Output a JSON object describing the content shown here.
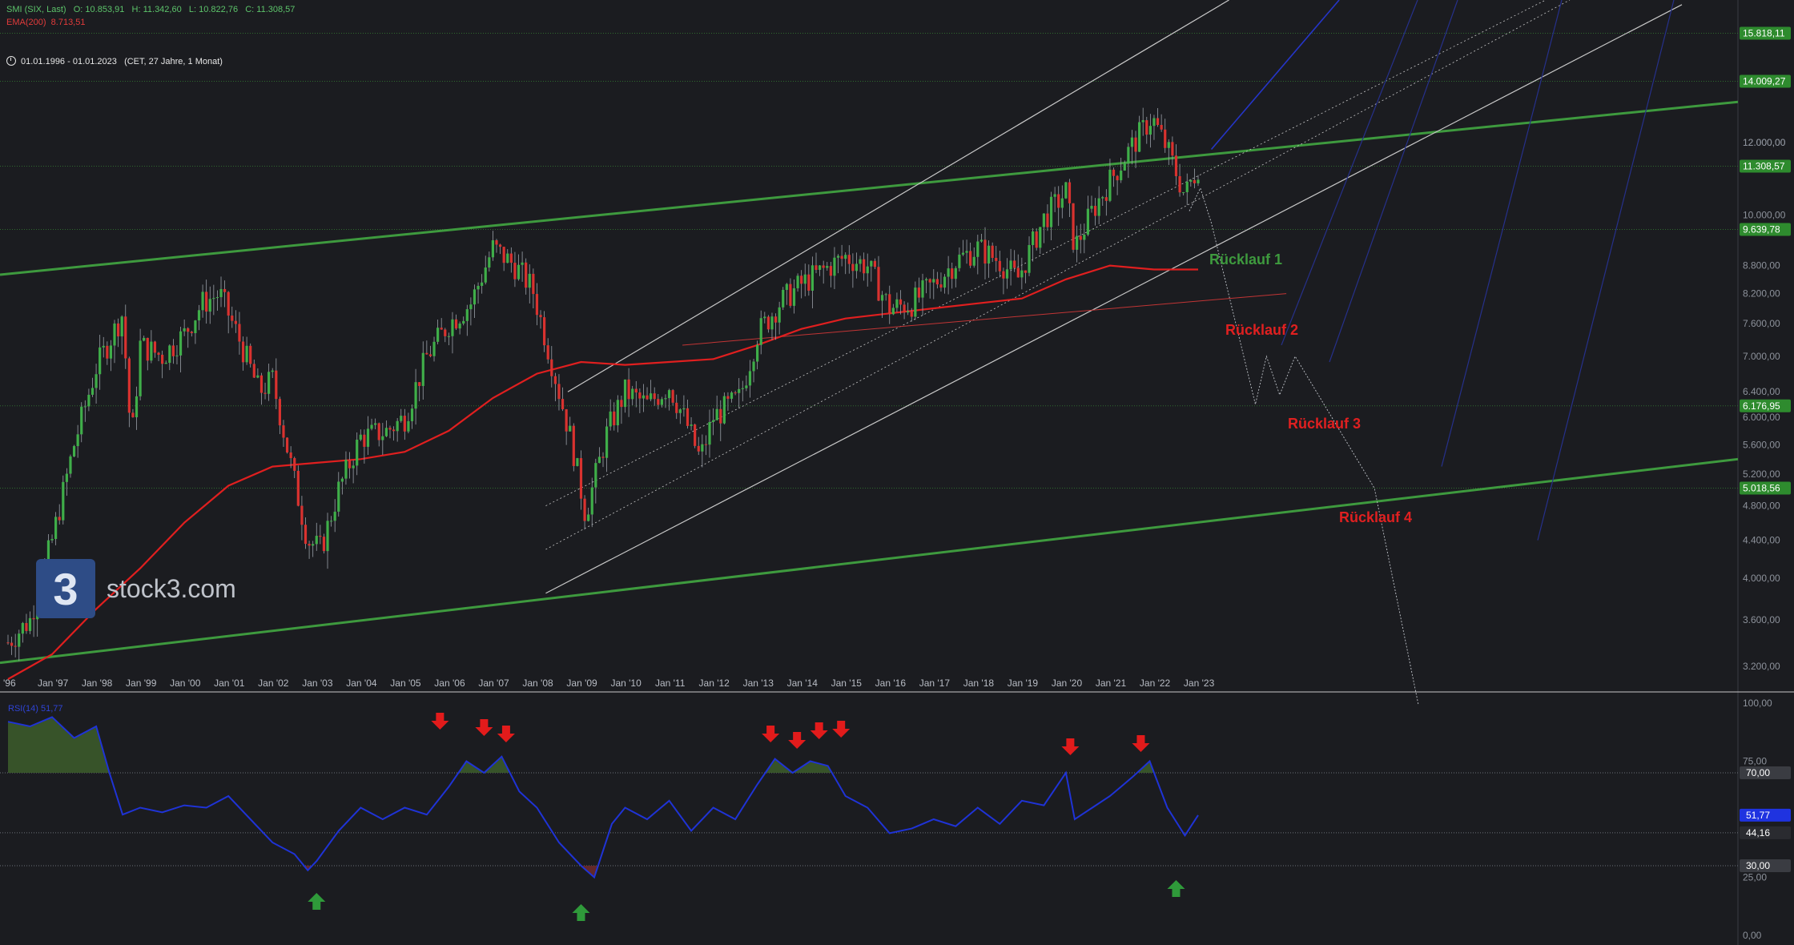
{
  "header": {
    "symbol_line": "SMI (SIX, Last)",
    "open": "O: 10.853,91",
    "high": "H: 11.342,60",
    "low": "L: 10.822,76",
    "close": "C: 11.308,57",
    "ema_label": "EMA(200)",
    "ema_value": "8.713,51",
    "range": "01.01.1996 - 01.01.2023",
    "range_meta": "(CET, 27 Jahre, 1 Monat)"
  },
  "logo": {
    "mark": "3",
    "text": "stock3.com"
  },
  "colors": {
    "bg": "#1b1c20",
    "candle_up": "#3fae49",
    "candle_down": "#d9322f",
    "trend_green": "#3e9a3e",
    "ema": "#e01f1f",
    "rsi": "#1f33d6",
    "rsi_fill": "#3b5a2a",
    "channel": "#c9c9c9",
    "badge_green": "#2e8b2e",
    "badge_blue": "#1f33e0"
  },
  "chart_data": [
    {
      "type": "candlestick",
      "title": "SMI (SIX, Last)",
      "x_ticks": [
        "'96",
        "Jan '97",
        "Jan '98",
        "Jan '99",
        "Jan '00",
        "Jan '01",
        "Jan '02",
        "Jan '03",
        "Jan '04",
        "Jan '05",
        "Jan '06",
        "Jan '07",
        "Jan '08",
        "Jan '09",
        "Jan '10",
        "Jan '11",
        "Jan '12",
        "Jan '13",
        "Jan '14",
        "Jan '15",
        "Jan '16",
        "Jan '17",
        "Jan '18",
        "Jan '19",
        "Jan '20",
        "Jan '21",
        "Jan '22",
        "Jan '23"
      ],
      "y_ticks": [
        "3.200,00",
        "3.600,00",
        "4.000,00",
        "4.400,00",
        "4.800,00",
        "5.200,00",
        "5.600,00",
        "6.000,00",
        "6.400,00",
        "7.000,00",
        "7.600,00",
        "8.200,00",
        "8.800,00",
        "10.000,00",
        "12.000,00"
      ],
      "y_scale": "log",
      "ylim": [
        3050,
        17200
      ],
      "series": [
        {
          "name": "SMI",
          "x": [
            1996.0,
            1996.5,
            1997.0,
            1997.5,
            1998.0,
            1998.6,
            1998.8,
            1999.0,
            1999.5,
            2000.0,
            2000.4,
            2000.8,
            2001.2,
            2001.7,
            2002.0,
            2002.5,
            2002.8,
            2003.1,
            2003.5,
            2004.0,
            2004.6,
            2005.0,
            2005.5,
            2006.0,
            2006.5,
            2007.0,
            2007.5,
            2007.9,
            2008.3,
            2008.8,
            2009.1,
            2009.6,
            2010.0,
            2010.5,
            2011.0,
            2011.4,
            2011.7,
            2012.0,
            2012.6,
            2013.0,
            2013.5,
            2014.0,
            2014.5,
            2015.0,
            2015.5,
            2016.0,
            2016.5,
            2017.0,
            2017.5,
            2018.0,
            2018.5,
            2018.9,
            2019.5,
            2020.0,
            2020.2,
            2020.6,
            2021.0,
            2021.5,
            2021.95,
            2022.3,
            2022.7,
            2023.0
          ],
          "close": [
            3400,
            3600,
            4400,
            5600,
            6800,
            7800,
            5600,
            7200,
            7000,
            7400,
            8000,
            8200,
            7400,
            6400,
            6600,
            5100,
            4400,
            4300,
            5000,
            5700,
            5800,
            6000,
            7000,
            7600,
            8000,
            9200,
            8800,
            8300,
            7000,
            5600,
            4700,
            5800,
            6400,
            6200,
            6500,
            5900,
            5400,
            6000,
            6300,
            7400,
            8000,
            8400,
            8700,
            9000,
            8800,
            7900,
            8000,
            8400,
            8900,
            9200,
            8900,
            8500,
            9900,
            10600,
            9200,
            10100,
            10900,
            11900,
            12800,
            11800,
            10500,
            11308.57
          ]
        }
      ]
    },
    {
      "type": "line",
      "series": [
        {
          "name": "EMA(200)",
          "x": [
            1996.0,
            1997.0,
            1998.0,
            1999.0,
            2000.0,
            2001.0,
            2002.0,
            2003.0,
            2004.0,
            2005.0,
            2006.0,
            2007.0,
            2008.0,
            2009.0,
            2010.0,
            2011.0,
            2012.0,
            2013.0,
            2014.0,
            2015.0,
            2016.0,
            2017.0,
            2018.0,
            2019.0,
            2020.0,
            2021.0,
            2022.0,
            2023.0
          ],
          "y": [
            3100,
            3300,
            3700,
            4100,
            4600,
            5050,
            5300,
            5350,
            5400,
            5500,
            5800,
            6300,
            6700,
            6900,
            6850,
            6900,
            6950,
            7200,
            7500,
            7700,
            7800,
            7900,
            8000,
            8100,
            8500,
            8800,
            8713.51,
            8713.51
          ]
        }
      ]
    },
    {
      "type": "line",
      "ylim": [
        0,
        100
      ],
      "y_ticks": [
        "100,00",
        "75,00",
        "25,00",
        "0,00"
      ],
      "series": [
        {
          "name": "RSI(14)",
          "x": [
            1996.0,
            1996.5,
            1997.0,
            1997.5,
            1998.0,
            1998.3,
            1998.6,
            1999.0,
            1999.5,
            2000.0,
            2000.5,
            2001.0,
            2001.5,
            2002.0,
            2002.5,
            2002.8,
            2003.0,
            2003.5,
            2004.0,
            2004.5,
            2005.0,
            2005.5,
            2006.0,
            2006.4,
            2006.8,
            2007.2,
            2007.6,
            2008.0,
            2008.5,
            2009.0,
            2009.3,
            2009.7,
            2010.0,
            2010.5,
            2011.0,
            2011.5,
            2012.0,
            2012.5,
            2013.0,
            2013.4,
            2013.8,
            2014.2,
            2014.6,
            2015.0,
            2015.5,
            2016.0,
            2016.5,
            2017.0,
            2017.5,
            2018.0,
            2018.5,
            2019.0,
            2019.5,
            2020.0,
            2020.2,
            2020.6,
            2021.0,
            2021.5,
            2021.9,
            2022.3,
            2022.7,
            2023.0
          ],
          "y": [
            92,
            90,
            94,
            85,
            90,
            70,
            52,
            55,
            53,
            56,
            55,
            60,
            50,
            40,
            35,
            28,
            32,
            45,
            55,
            50,
            55,
            52,
            64,
            75,
            70,
            77,
            62,
            55,
            40,
            30,
            25,
            48,
            55,
            50,
            58,
            45,
            55,
            50,
            65,
            76,
            70,
            75,
            73,
            60,
            55,
            44,
            46,
            50,
            47,
            55,
            48,
            58,
            56,
            70,
            50,
            55,
            60,
            68,
            75,
            55,
            43,
            51.77
          ]
        }
      ]
    }
  ],
  "price_labels": [
    {
      "value": "15.818,11",
      "color": "green"
    },
    {
      "value": "14.009,27",
      "color": "green"
    },
    {
      "value": "12.000,00",
      "color": "tick"
    },
    {
      "value": "11.308,57",
      "color": "green"
    },
    {
      "value": "9.639,78",
      "color": "green"
    },
    {
      "value": "6.176,95",
      "color": "green"
    },
    {
      "value": "5.018,56",
      "color": "green"
    }
  ],
  "rsi_labels": [
    {
      "value": "70,00",
      "color": "gray"
    },
    {
      "value": "51,77",
      "color": "blue"
    },
    {
      "value": "44,16",
      "color": "dark"
    },
    {
      "value": "30,00",
      "color": "gray"
    }
  ],
  "rsi_header": {
    "label": "RSI(14)",
    "value": "51,77"
  },
  "annotations": [
    {
      "text": "Rücklauf 1",
      "color": "green"
    },
    {
      "text": "Rücklauf 2",
      "color": "red"
    },
    {
      "text": "Rücklauf 3",
      "color": "red"
    },
    {
      "text": "Rücklauf 4",
      "color": "red"
    }
  ],
  "arrows": {
    "down_dates": [
      2005.8,
      2006.8,
      2007.3,
      2013.3,
      2013.9,
      2014.4,
      2014.9,
      2020.1,
      2021.7
    ],
    "up_dates": [
      2003.0,
      2009.0,
      2022.5
    ]
  }
}
